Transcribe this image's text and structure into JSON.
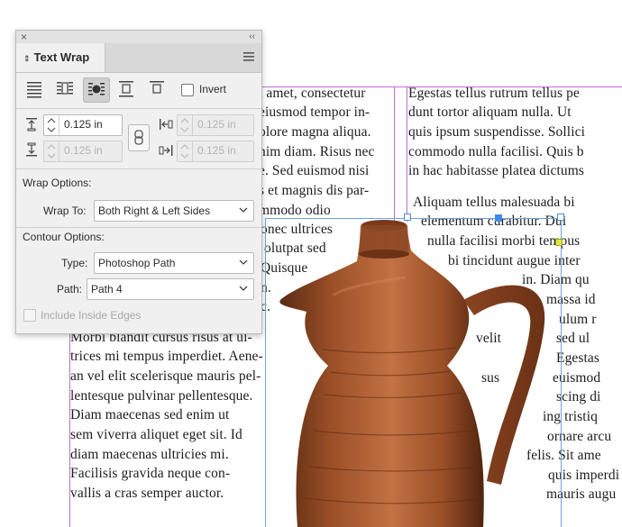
{
  "document": {
    "col1_top": [
      "t amet, consectetur",
      "eiusmod tempor in-",
      "olore magna aliqua.",
      "nim diam. Risus nec",
      "e. Sed euismod nisi",
      "s et magnis dis par-",
      "mmodo odio"
    ],
    "col1_mid": [
      "onec ultrices",
      "olutpat sed",
      "Quisque",
      "n.",
      "c."
    ],
    "col1_bottom": [
      "Morbi blandit cursus risus at ul-",
      "trices mi tempus imperdiet. Aene-",
      "an vel elit scelerisque mauris pel-",
      "lentesque pulvinar pellentesque.",
      "Diam  maecenas  sed  enim  ut",
      "sem viverra aliquet eget sit. Id",
      "diam maecenas ultricies mi.",
      "Facilisis gravida neque con-",
      "vallis a cras semper auctor."
    ],
    "col2_top": [
      "Egestas tellus rutrum tellus pe",
      "dunt tortor aliquam nulla. Ut",
      "quis ipsum suspendisse. Sollici",
      "commodo nulla facilisi. Quis b",
      "in hac habitasse platea dictums"
    ],
    "col2_mid": [
      "Aliquam tellus malesuada bi",
      "elementum curabitur. Dui",
      "nulla facilisi morbi tempus",
      "bi tincidunt augue inter",
      "in. Diam qu",
      "massa id",
      "ulum r",
      "velit",
      "sed ul",
      "Egestas",
      "sus",
      "euismod",
      "scing di",
      "ing tristiq",
      "ornare arcu",
      "felis. Sit ame",
      "quis imperdi",
      "mauris augu"
    ]
  },
  "panel": {
    "title": "Text Wrap",
    "invert_label": "Invert",
    "offsets": {
      "top": "0.125 in",
      "bottom": "0.125 in",
      "left": "0.125 in",
      "right": "0.125 in"
    },
    "wrap_options_heading": "Wrap Options:",
    "wrap_to_label": "Wrap To:",
    "wrap_to_value": "Both Right & Left Sides",
    "contour_options_heading": "Contour Options:",
    "type_label": "Type:",
    "type_value": "Photoshop Path",
    "path_label": "Path:",
    "path_value": "Path 4",
    "include_inside_edges_label": "Include Inside Edges"
  },
  "colors": {
    "guide": "#c86bd7",
    "frame": "#6aa3e0",
    "jug_dark": "#6b3318",
    "jug_mid": "#a4582f",
    "jug_light": "#c8784a"
  }
}
